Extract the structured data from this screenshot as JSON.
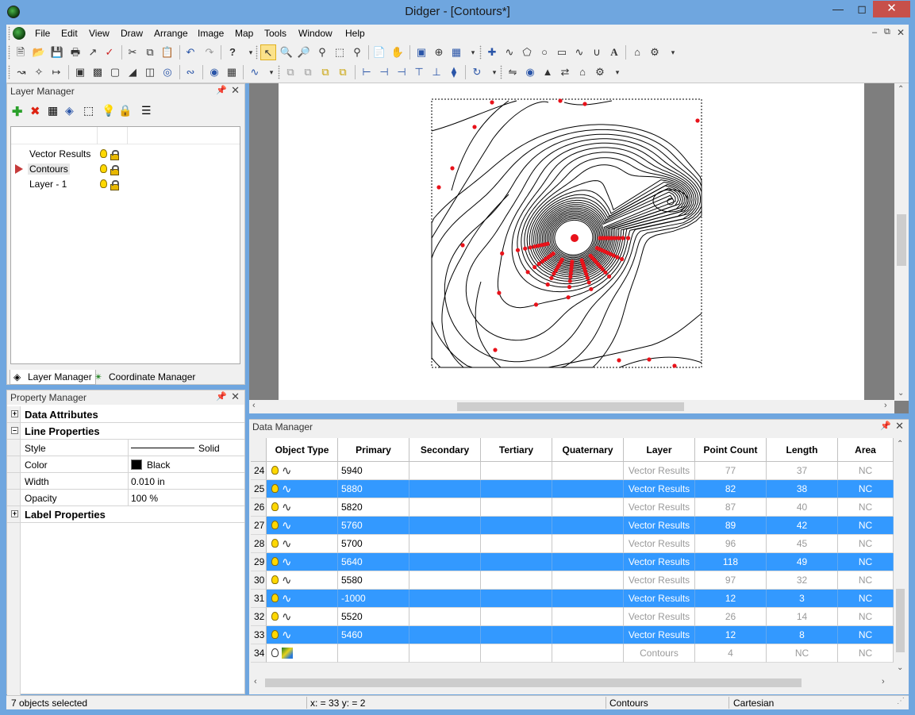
{
  "window": {
    "title": "Didger - [Contours*]"
  },
  "menu": [
    "File",
    "Edit",
    "View",
    "Draw",
    "Arrange",
    "Image",
    "Map",
    "Tools",
    "Window",
    "Help"
  ],
  "layer_manager": {
    "title": "Layer Manager",
    "layers": [
      "Vector Results",
      "Contours",
      "Layer - 1"
    ],
    "active_layer": "Contours",
    "tabs": [
      "Layer Manager",
      "Coordinate Manager"
    ]
  },
  "property_manager": {
    "title": "Property Manager",
    "sections": {
      "data_attributes": "Data Attributes",
      "line_properties": "Line Properties",
      "label_properties": "Label Properties"
    },
    "props": {
      "style_key": "Style",
      "style_val": "Solid",
      "color_key": "Color",
      "color_val": "Black",
      "width_key": "Width",
      "width_val": "0.010 in",
      "opacity_key": "Opacity",
      "opacity_val": "100 %"
    }
  },
  "data_manager": {
    "title": "Data Manager",
    "columns": [
      "Object Type",
      "Primary",
      "Secondary",
      "Tertiary",
      "Quaternary",
      "Layer",
      "Point Count",
      "Length",
      "Area"
    ],
    "rows": [
      {
        "n": "24",
        "primary": "5940",
        "layer": "Vector Results",
        "count": "77",
        "length": "37",
        "area": "NC",
        "selected": false,
        "kind": "line"
      },
      {
        "n": "25",
        "primary": "5880",
        "layer": "Vector Results",
        "count": "82",
        "length": "38",
        "area": "NC",
        "selected": true,
        "kind": "line"
      },
      {
        "n": "26",
        "primary": "5820",
        "layer": "Vector Results",
        "count": "87",
        "length": "40",
        "area": "NC",
        "selected": false,
        "kind": "line"
      },
      {
        "n": "27",
        "primary": "5760",
        "layer": "Vector Results",
        "count": "89",
        "length": "42",
        "area": "NC",
        "selected": true,
        "kind": "line"
      },
      {
        "n": "28",
        "primary": "5700",
        "layer": "Vector Results",
        "count": "96",
        "length": "45",
        "area": "NC",
        "selected": false,
        "kind": "line"
      },
      {
        "n": "29",
        "primary": "5640",
        "layer": "Vector Results",
        "count": "118",
        "length": "49",
        "area": "NC",
        "selected": true,
        "kind": "line"
      },
      {
        "n": "30",
        "primary": "5580",
        "layer": "Vector Results",
        "count": "97",
        "length": "32",
        "area": "NC",
        "selected": false,
        "kind": "line"
      },
      {
        "n": "31",
        "primary": "-1000",
        "layer": "Vector Results",
        "count": "12",
        "length": "3",
        "area": "NC",
        "selected": true,
        "kind": "line"
      },
      {
        "n": "32",
        "primary": "5520",
        "layer": "Vector Results",
        "count": "26",
        "length": "14",
        "area": "NC",
        "selected": false,
        "kind": "line"
      },
      {
        "n": "33",
        "primary": "5460",
        "layer": "Vector Results",
        "count": "12",
        "length": "8",
        "area": "NC",
        "selected": true,
        "kind": "line"
      },
      {
        "n": "34",
        "primary": "",
        "layer": "Contours",
        "count": "4",
        "length": "NC",
        "area": "NC",
        "selected": false,
        "kind": "image"
      }
    ]
  },
  "status": {
    "selection": "7 objects selected",
    "coords": "x: = 33 y: = 2",
    "layer": "Contours",
    "system": "Cartesian"
  },
  "colors": {
    "selection": "#3399ff",
    "titlebar": "#6fa6df",
    "digitized_points": "#e8121a"
  }
}
